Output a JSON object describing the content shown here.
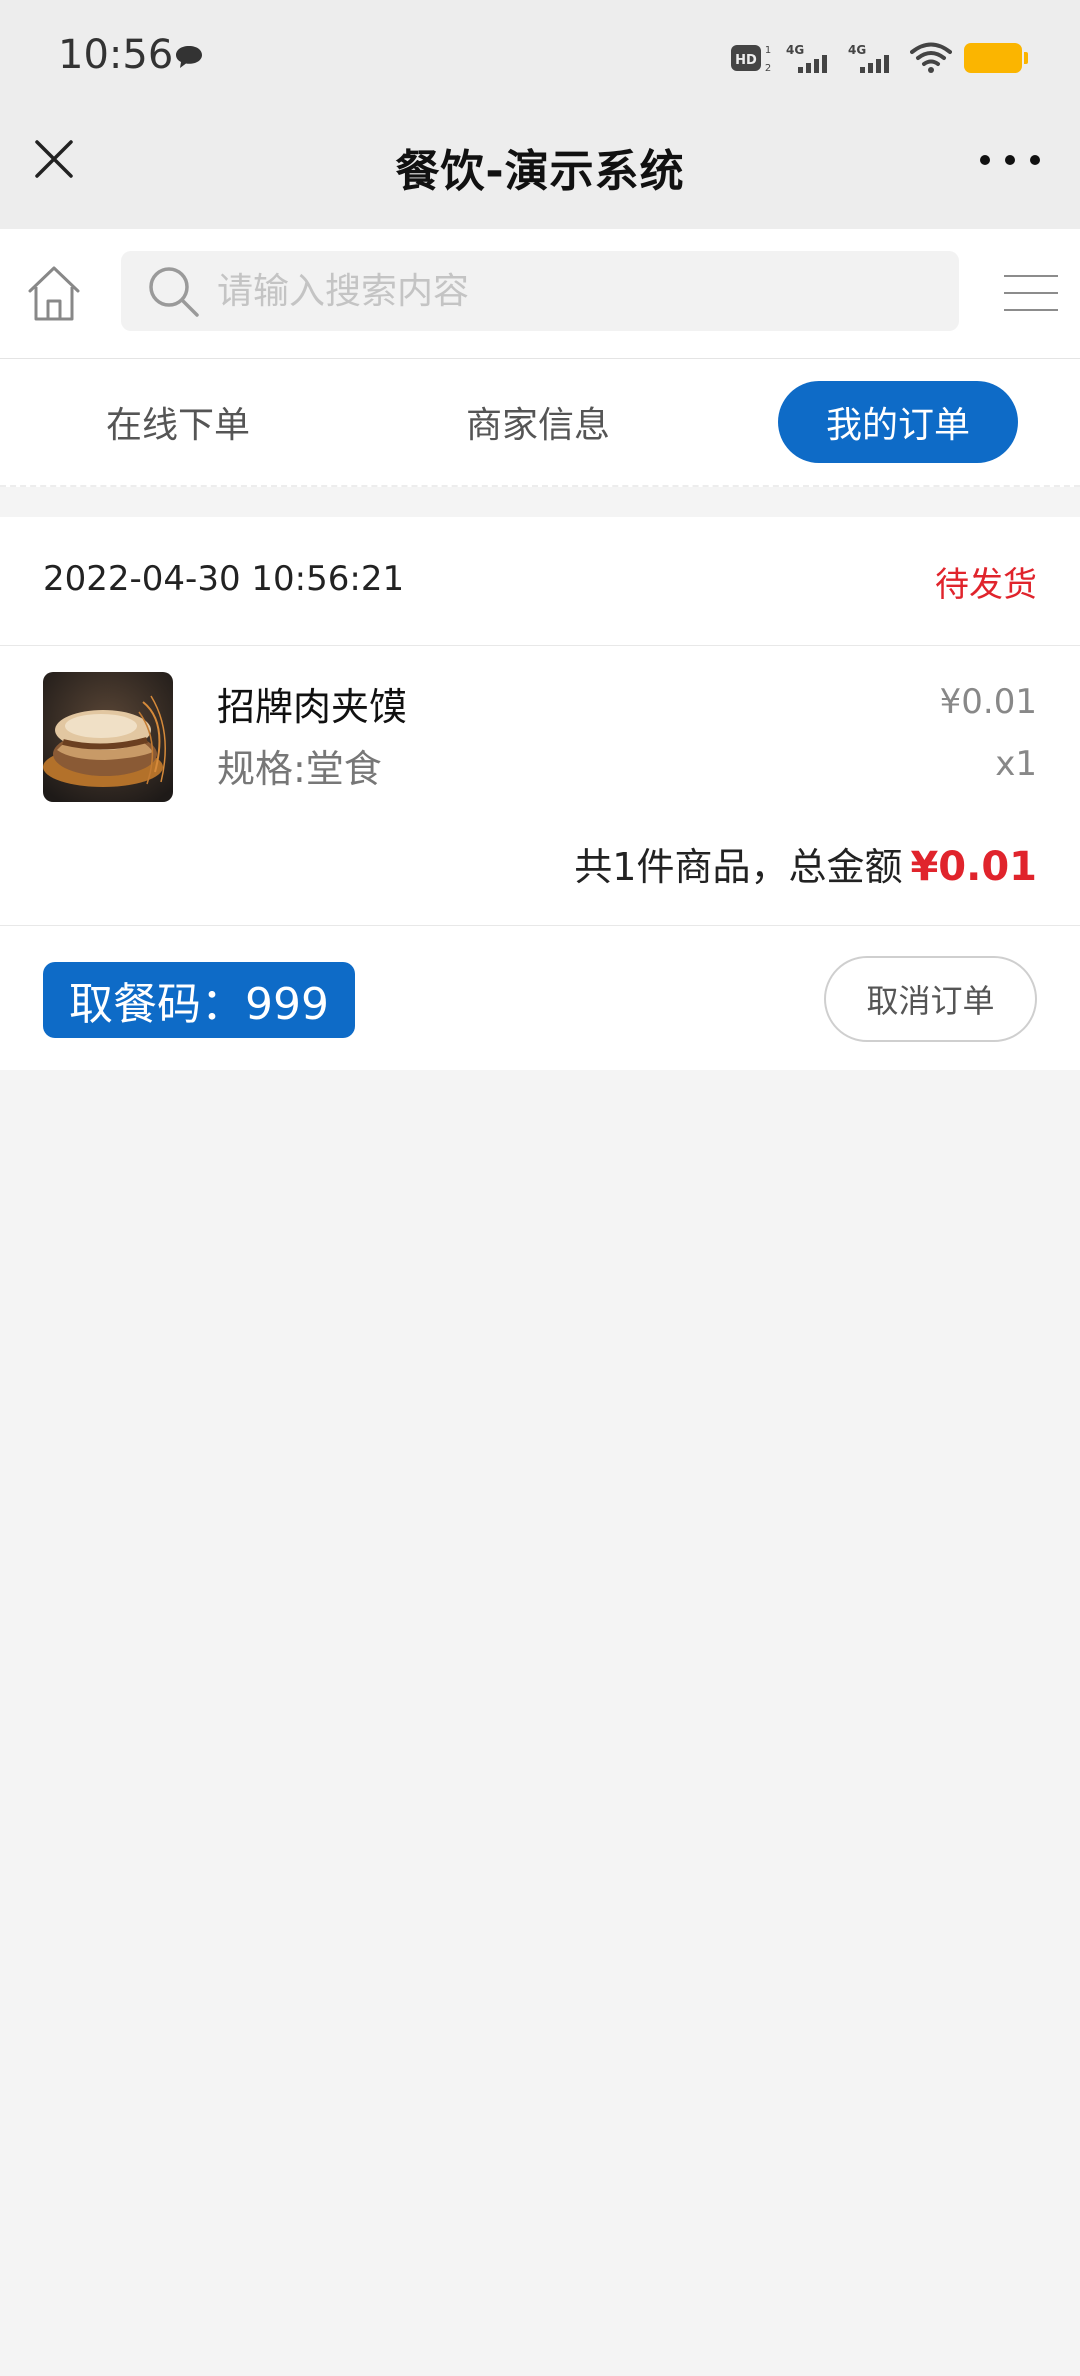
{
  "status_bar": {
    "time": "10:56",
    "message_icon": "chat-bubble-icon",
    "hd_label": "HD",
    "signal_1_label": "4G",
    "signal_2_label": "4G",
    "wifi_icon": "wifi-icon",
    "battery_color": "#fbb500"
  },
  "title_bar": {
    "title": "餐饮-演示系统",
    "close_icon": "close-icon",
    "more_icon": "more-dots-icon"
  },
  "search": {
    "placeholder": "请输入搜索内容",
    "value": "",
    "home_icon": "home-icon",
    "search_icon": "search-icon",
    "menu_icon": "hamburger-menu-icon"
  },
  "tabs": [
    {
      "label": "在线下单",
      "active": false
    },
    {
      "label": "商家信息",
      "active": false
    },
    {
      "label": "我的订单",
      "active": true
    }
  ],
  "order": {
    "datetime": "2022-04-30 10:56:21",
    "status": "待发货",
    "product": {
      "name": "招牌肉夹馍",
      "spec": "规格:堂食",
      "price": "¥0.01",
      "quantity": "x1"
    },
    "summary_label": "共1件商品，总金额",
    "total": "¥0.01",
    "pickup_code_label": "取餐码：999",
    "cancel_label": "取消订单"
  },
  "colors": {
    "accent": "#0e6bc7",
    "status_red": "#e0242c",
    "background": "#f4f4f4",
    "chrome": "#ededed"
  }
}
